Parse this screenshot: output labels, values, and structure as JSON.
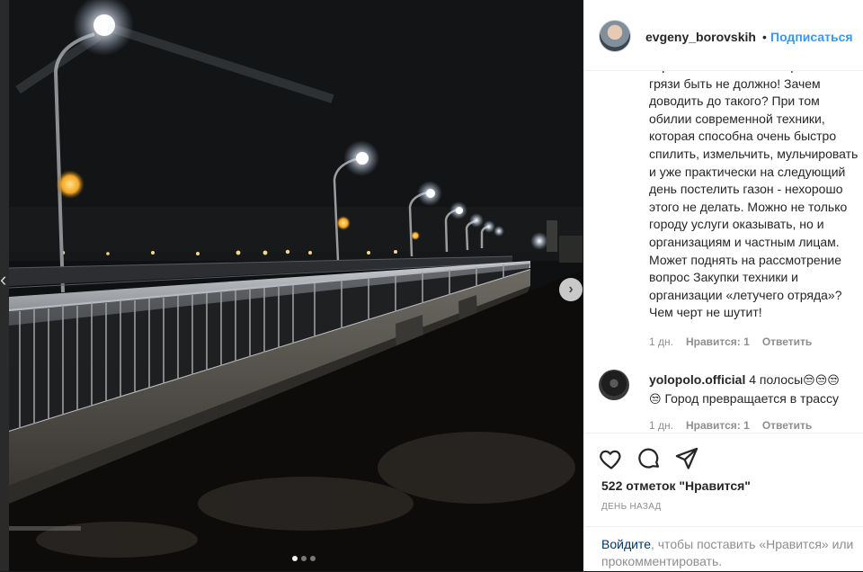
{
  "post": {
    "username": "evgeny_borovskih",
    "follow_separator": "•",
    "follow_label": "Подписаться",
    "comments": [
      {
        "text": "заросли и чистим... А зарослей и\nгрязи быть не должно! Зачем\nдоводить до такого? При том\nобилии современной техники,\nкоторая способна очень быстро\nспилить, измельчить, мульчировать\nи уже практически на следующий\nдень постелить газон - нехорошо\nэтого не делать. Можно не только\nгороду услуги оказывать, но и\nорганизациям и частным лицам.\nМожет поднять на рассмотрение\nвопрос Закупки техники и\nорганизации «летучего отряда»?\nЧем черт не шутит!",
        "time": "1 дн.",
        "likes": "Нравится: 1",
        "reply": "Ответить"
      },
      {
        "username": "yolopolo.official",
        "text_part1": "4 полосы",
        "emoji_row1": "😒😒😒",
        "emoji_row2": "😒",
        "text_part2": "Город превращается в трассу",
        "time": "1 дн.",
        "likes": "Нравится: 1",
        "reply": "Ответить"
      }
    ],
    "likes_count": "522 отметок \"Нравится\"",
    "date": "ДЕНЬ НАЗАД",
    "login_link": "Войдите",
    "login_rest": ", чтобы поставить «Нравится» или прокомментировать."
  },
  "carousel": {
    "total_slides": 3,
    "active_slide": 1
  },
  "icons": [
    "heart-icon",
    "comment-icon",
    "share-icon",
    "chevron-right-icon",
    "chevron-left-icon"
  ],
  "colors": {
    "link": "#3897f0",
    "text": "#262626",
    "muted": "#8e8e8e",
    "login_link": "#003569"
  }
}
